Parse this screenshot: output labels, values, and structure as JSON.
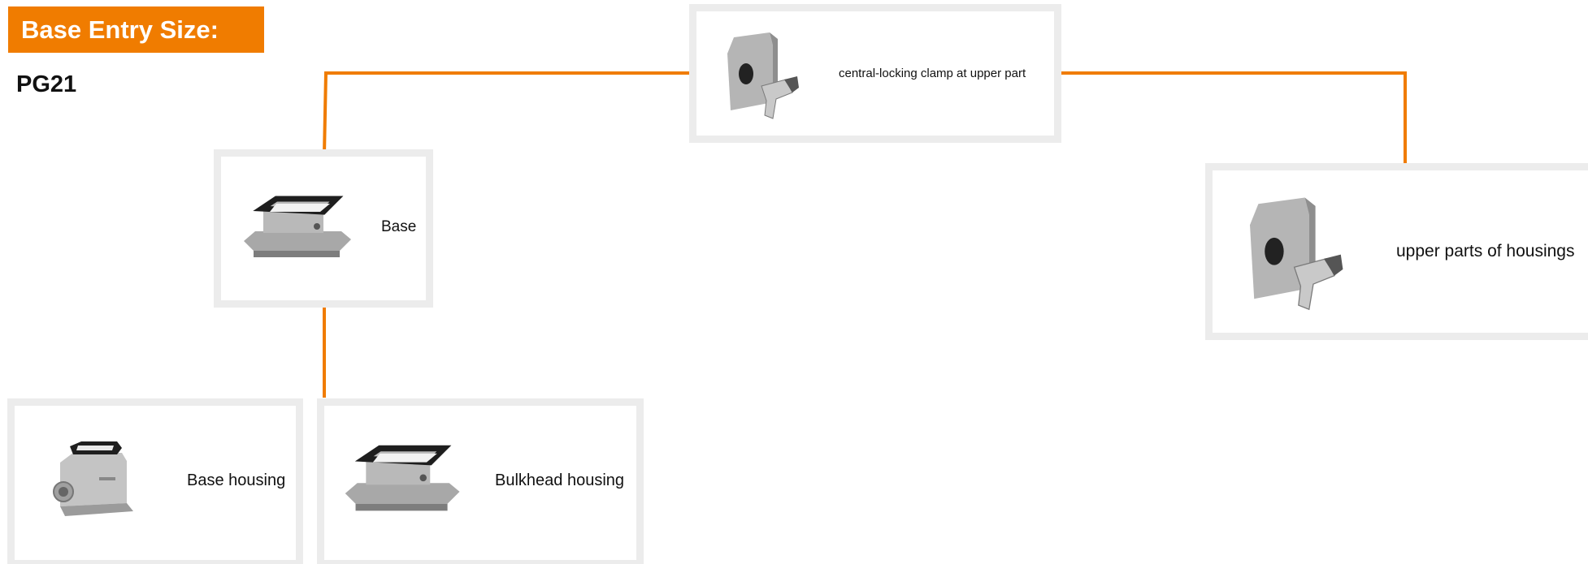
{
  "header": {
    "title": "Base Entry Size:",
    "value": "PG21"
  },
  "colors": {
    "accent": "#f07c00",
    "card_border": "#ececec",
    "part_grey": "#a9a9a9"
  },
  "nodes": {
    "central_clamp": {
      "label": "central-locking clamp at upper part",
      "icon": "hood-housing-icon"
    },
    "base": {
      "label": "Base",
      "icon": "base-frame-icon"
    },
    "upper_parts": {
      "label": "upper parts of housings",
      "icon": "hood-housing-icon"
    },
    "base_housing": {
      "label": "Base housing",
      "icon": "base-housing-icon"
    },
    "bulkhead_housing": {
      "label": "Bulkhead housing",
      "icon": "bulkhead-frame-icon"
    }
  }
}
